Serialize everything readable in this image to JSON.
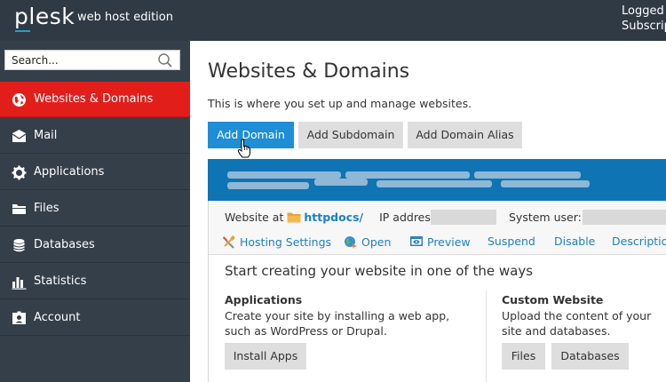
{
  "header": {
    "logo": "plesk",
    "edition": "web host edition",
    "login_line1": "Logged in as",
    "login_line2": "Subscription"
  },
  "sidebar": {
    "search_placeholder": "Search...",
    "items": [
      {
        "label": "Websites & Domains",
        "icon": "globe-icon",
        "active": true
      },
      {
        "label": "Mail",
        "icon": "envelope-icon"
      },
      {
        "label": "Applications",
        "icon": "gear-icon"
      },
      {
        "label": "Files",
        "icon": "folder-icon"
      },
      {
        "label": "Databases",
        "icon": "database-icon"
      },
      {
        "label": "Statistics",
        "icon": "bar-chart-icon"
      },
      {
        "label": "Account",
        "icon": "id-card-icon"
      }
    ]
  },
  "main": {
    "title": "Websites & Domains",
    "description": "This is where you set up and manage websites.",
    "buttons": {
      "add_domain": "Add Domain",
      "add_subdomain": "Add Subdomain",
      "add_domain_alias": "Add Domain Alias"
    },
    "domain": {
      "website_at_label": "Website at",
      "docroot": "httpdocs/",
      "ip_label": "IP address:",
      "system_user_label": "System user:",
      "actions": [
        {
          "label": "Hosting Settings",
          "icon": "tools-icon"
        },
        {
          "label": "Open",
          "icon": "globe-open-icon"
        },
        {
          "label": "Preview",
          "icon": "preview-icon"
        },
        {
          "label": "Suspend"
        },
        {
          "label": "Disable"
        },
        {
          "label": "Description"
        }
      ],
      "start_title": "Start creating your website in one of the ways",
      "applications": {
        "title": "Applications",
        "desc": "Create your site by installing a web app, such as WordPress or Drupal.",
        "button": "Install Apps"
      },
      "custom": {
        "title": "Custom Website",
        "desc": "Upload the content of your site and databases.",
        "buttons": [
          "Files",
          "Databases"
        ]
      }
    }
  },
  "colors": {
    "topbar": "#2f3a45",
    "sidebar": "#353f4a",
    "active": "#e21e1b",
    "primary": "#1e8ed6",
    "domain_bar": "#0e74b4",
    "link": "#1e7fc2"
  }
}
